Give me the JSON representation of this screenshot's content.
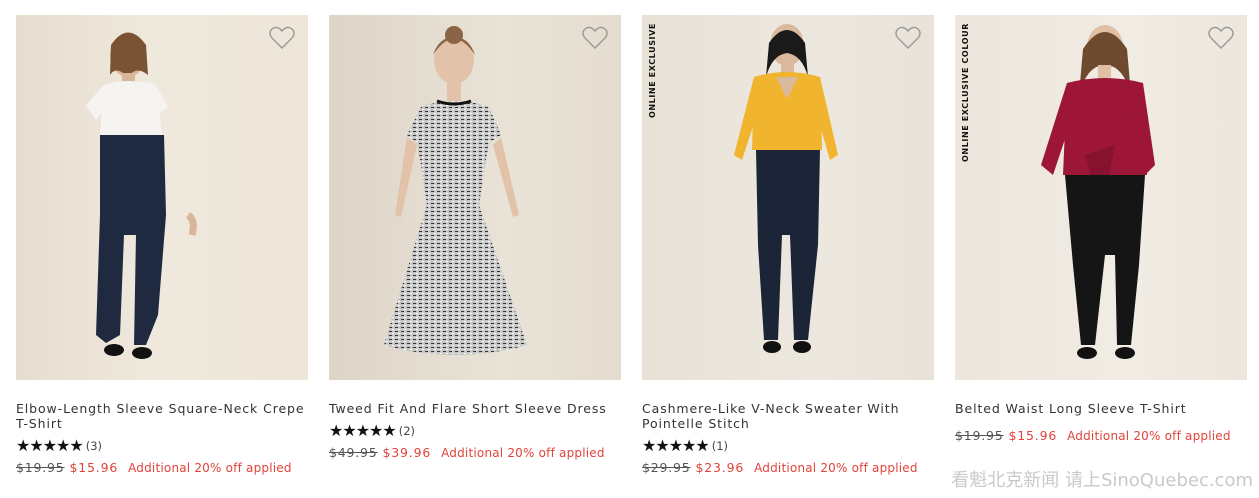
{
  "products": [
    {
      "title": "Elbow-Length Sleeve Square-Neck Crepe T-Shirt",
      "stars": "★★★★★",
      "review_count": "(3)",
      "rating": 5,
      "original_price": "$19.95",
      "sale_price": "$15.96",
      "promo": "Additional 20% off applied",
      "badge": ""
    },
    {
      "title": "Tweed Fit And Flare Short Sleeve Dress",
      "stars": "★★★★★",
      "review_count": "(2)",
      "rating": 5,
      "original_price": "$49.95",
      "sale_price": "$39.96",
      "promo": "Additional 20% off applied",
      "badge": ""
    },
    {
      "title": "Cashmere-Like V-Neck Sweater With Pointelle Stitch",
      "stars": "★★★★★",
      "review_count": "(1)",
      "rating": 5,
      "original_price": "$29.95",
      "sale_price": "$23.96",
      "promo": "Additional 20% off applied",
      "badge": "ONLINE EXCLUSIVE"
    },
    {
      "title": "Belted Waist Long Sleeve T-Shirt",
      "original_price": "$19.95",
      "sale_price": "$15.96",
      "promo": "Additional 20% off applied",
      "badge": "ONLINE EXCLUSIVE COLOUR"
    }
  ],
  "watermark": "看魁北克新闻 请上SinoQuebec.com",
  "colors": {
    "sale": "#e2433b",
    "text": "#333333"
  },
  "icons": {
    "wishlist": "heart-outline-icon"
  }
}
